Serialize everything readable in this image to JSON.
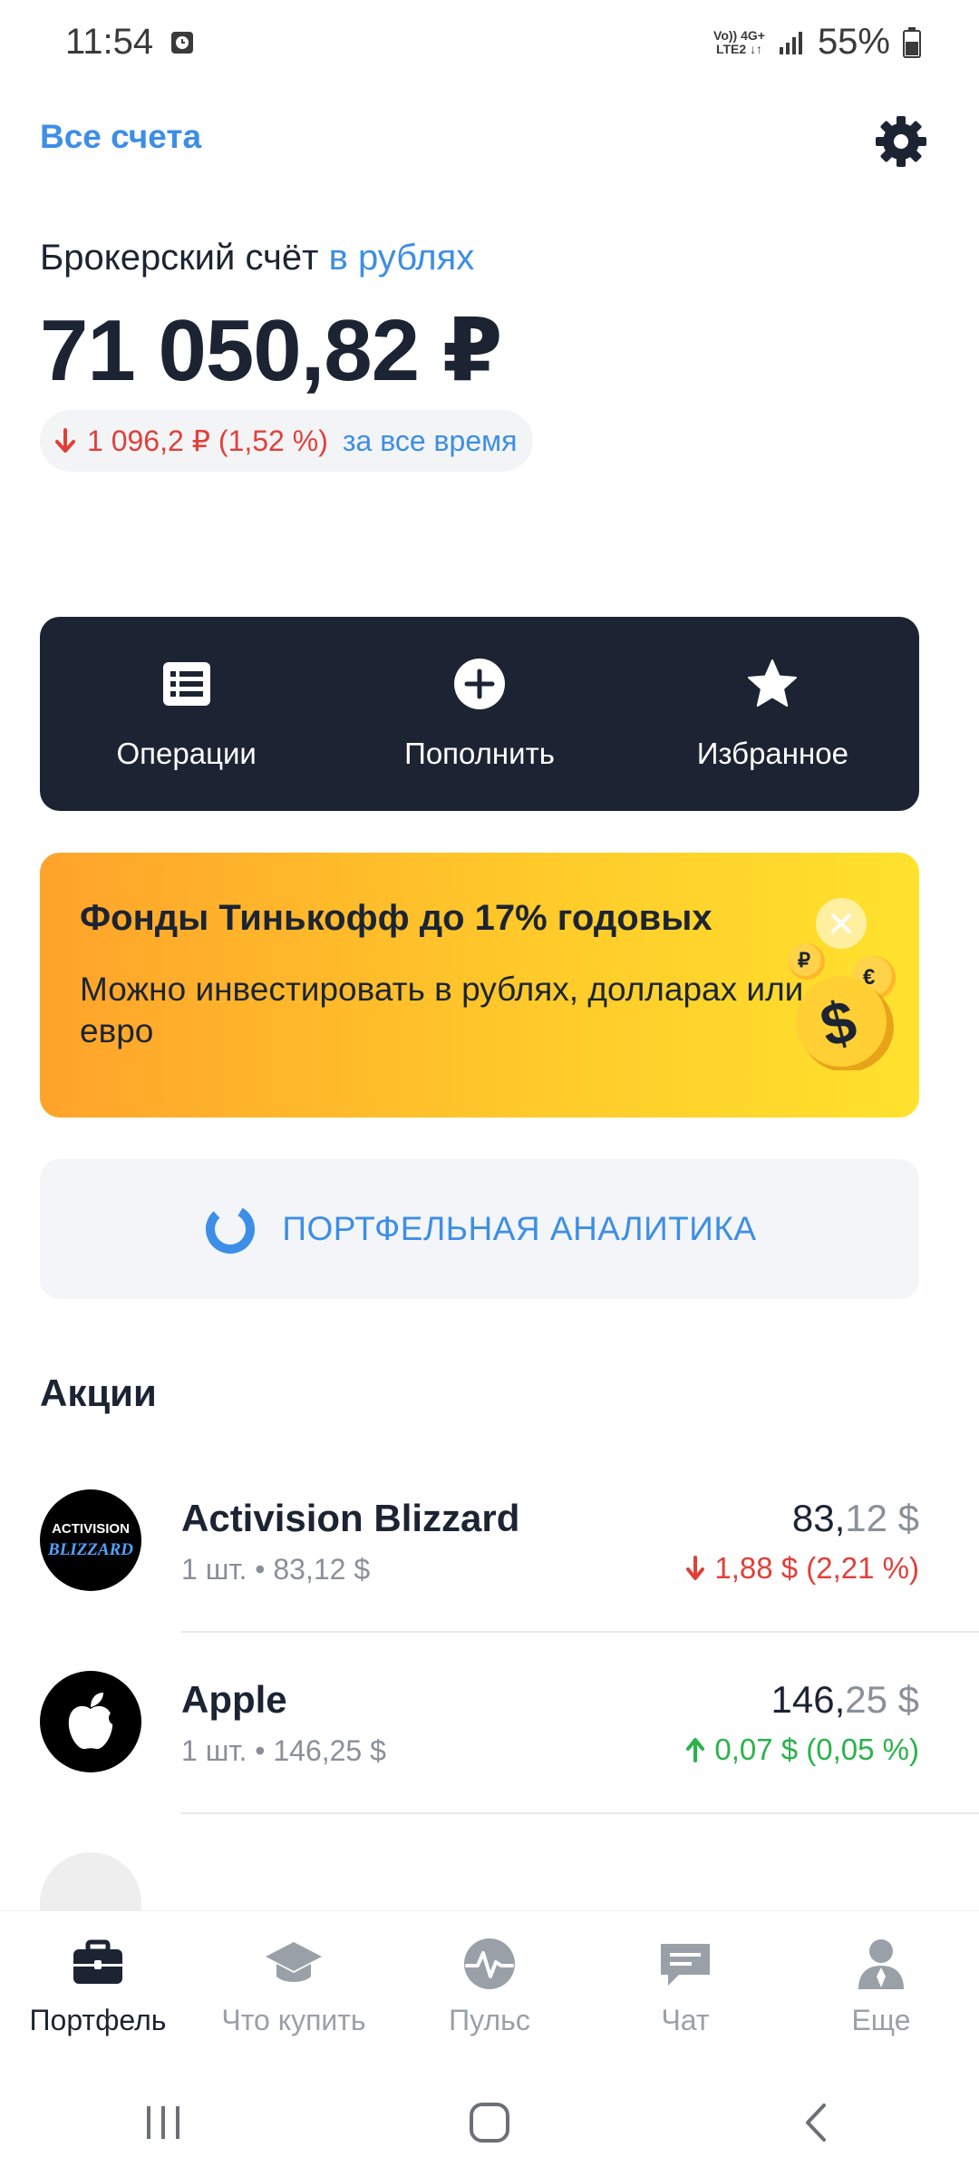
{
  "status_bar": {
    "time": "11:54",
    "network_top": "Vo)) 4G+",
    "network_bottom": "LTE2 ↓↑",
    "battery": "55%"
  },
  "header": {
    "all_accounts": "Все счета"
  },
  "account": {
    "title": "Брокерский счёт",
    "currency": "в рублях",
    "balance": "71 050,82 ₽",
    "change_value": "1 096,2 ₽ (1,52 %)",
    "change_period": "за все время"
  },
  "actions": [
    {
      "label": "Операции",
      "icon": "list-icon"
    },
    {
      "label": "Пополнить",
      "icon": "plus-circle-icon"
    },
    {
      "label": "Избранное",
      "icon": "star-icon"
    }
  ],
  "banner": {
    "title": "Фонды Тинькофф до 17% годовых",
    "text": "Можно инвестировать в рублях, долларах или евро",
    "coin_rub": "₽",
    "coin_eur": "€",
    "coin_usd": "$"
  },
  "analytics": {
    "label": "ПОРТФЕЛЬНАЯ АНАЛИТИКА"
  },
  "stocks_section": {
    "title": "Акции",
    "items": [
      {
        "name": "Activision Blizzard",
        "sub": "1 шт. • 83,12 $",
        "price_int": "83,",
        "price_frac": "12 $",
        "change": "1,88 $ (2,21 %)",
        "direction": "down",
        "logo_top": "ACTIVISION",
        "logo_bottom": "BLIZZARD"
      },
      {
        "name": "Apple",
        "sub": "1 шт. • 146,25 $",
        "price_int": "146,",
        "price_frac": "25 $",
        "change": "0,07 $ (0,05 %)",
        "direction": "up"
      }
    ]
  },
  "bottom_nav": [
    {
      "label": "Портфель",
      "icon": "briefcase-icon",
      "active": true
    },
    {
      "label": "Что купить",
      "icon": "graduation-cap-icon",
      "active": false
    },
    {
      "label": "Пульс",
      "icon": "pulse-icon",
      "active": false
    },
    {
      "label": "Чат",
      "icon": "chat-icon",
      "active": false
    },
    {
      "label": "Еще",
      "icon": "person-icon",
      "active": false
    }
  ],
  "colors": {
    "accent_blue": "#3d8ee6",
    "dark": "#1c2433",
    "negative": "#e0403a",
    "positive": "#2bb24c",
    "banner_start": "#ffa32b",
    "banner_end": "#ffe22d"
  }
}
